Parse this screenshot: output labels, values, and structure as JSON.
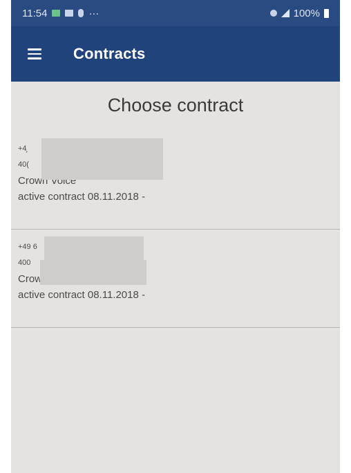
{
  "statusbar": {
    "time": "11:54",
    "dots": "···",
    "battery": "100%"
  },
  "appbar": {
    "title": "Contracts"
  },
  "heading": "Choose contract",
  "contracts": [
    {
      "phone": "+4̧",
      "id": "40(",
      "product": "Crown Voice",
      "status": "active contract  08.11.2018 -"
    },
    {
      "phone": "+49 6",
      "id": "400",
      "product": "Crown Voice",
      "status": "active contract  08.11.2018 -"
    }
  ],
  "icons": {
    "menu": "hamburger-icon",
    "signal": "signal-icon",
    "battery": "battery-icon"
  },
  "colors": {
    "appbar": "#21437c",
    "statusbar": "#2a4a82",
    "background": "#e5e3e0"
  }
}
